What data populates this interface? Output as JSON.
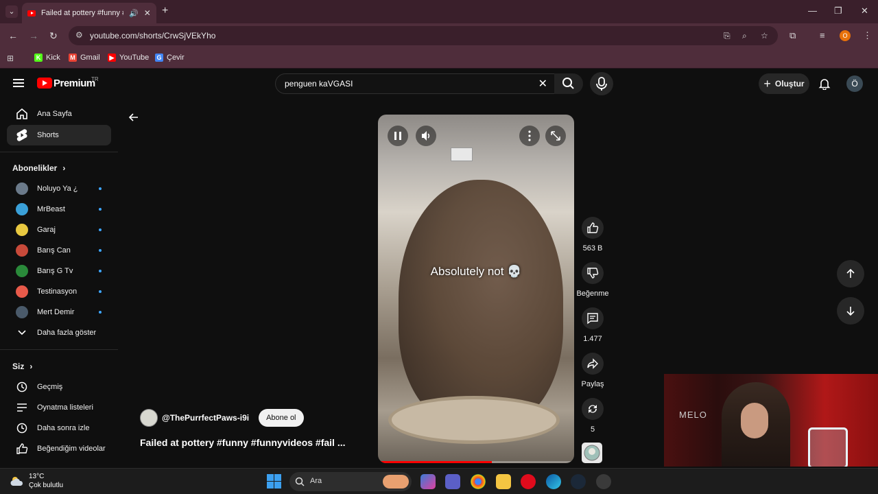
{
  "browser": {
    "tab_title": "Failed at pottery #funny #fu",
    "url": "youtube.com/shorts/CrwSjVEkYho",
    "bookmarks": [
      {
        "label": "Kick",
        "icon": "kick-icon",
        "color": "#53fc18",
        "glyph": "K"
      },
      {
        "label": "Gmail",
        "icon": "gmail-icon",
        "color": "#ea4335",
        "glyph": "M"
      },
      {
        "label": "YouTube",
        "icon": "youtube-icon",
        "color": "#ff0000",
        "glyph": "▶"
      },
      {
        "label": "Çevir",
        "icon": "translate-icon",
        "color": "#4285f4",
        "glyph": "G"
      }
    ],
    "profile_initial": "O"
  },
  "header": {
    "logo_text": "Premium",
    "logo_country": "TR",
    "search_query": "penguen kaVGASI",
    "create_label": "Oluştur",
    "avatar_initial": "Ö"
  },
  "sidebar": {
    "main": [
      {
        "label": "Ana Sayfa",
        "icon": "home-icon"
      },
      {
        "label": "Shorts",
        "icon": "shorts-icon",
        "active": true
      }
    ],
    "subscriptions_title": "Abonelikler",
    "subscriptions": [
      {
        "label": "Noluyo Ya ¿",
        "color": "#6b7a8a"
      },
      {
        "label": "MrBeast",
        "color": "#3aa0d8"
      },
      {
        "label": "Garaj",
        "color": "#e8c840"
      },
      {
        "label": "Barış Can",
        "color": "#c84a3a"
      },
      {
        "label": "Barış G Tv",
        "color": "#2a8a3a"
      },
      {
        "label": "Testinasyon",
        "color": "#e85a4a"
      },
      {
        "label": "Mert Demir",
        "color": "#4a5a6a"
      }
    ],
    "show_more_label": "Daha fazla göster",
    "you_title": "Siz",
    "you_items": [
      {
        "label": "Geçmiş",
        "icon": "history-icon"
      },
      {
        "label": "Oynatma listeleri",
        "icon": "playlist-icon"
      },
      {
        "label": "Daha sonra izle",
        "icon": "watch-later-icon"
      },
      {
        "label": "Beğendiğim videolar",
        "icon": "liked-icon"
      }
    ]
  },
  "short": {
    "caption": "Absolutely not 💀",
    "progress_percent": 58,
    "channel": "@ThePurrfectPaws-i9i",
    "subscribe_label": "Abone ol",
    "title": "Failed at pottery #funny #funnyvideos #fail ..."
  },
  "actions": {
    "like_count": "563 B",
    "dislike_label": "Beğenme",
    "comment_count": "1.477",
    "share_label": "Paylaş",
    "remix_count": "5"
  },
  "overlay": {
    "webcam_text": "MELO"
  },
  "taskbar": {
    "temperature": "13°C",
    "weather": "Çok bulutlu",
    "search_label": "Ara"
  }
}
